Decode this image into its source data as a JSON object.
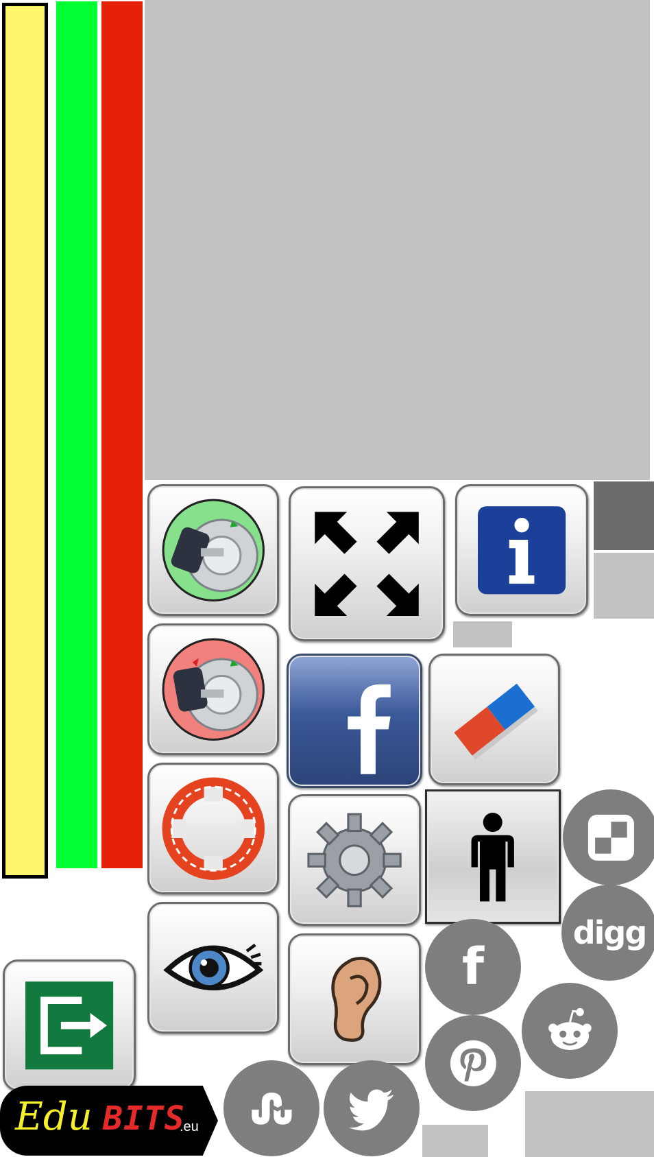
{
  "sprite": {
    "bars": [
      {
        "name": "yellow",
        "color": "#fff66e",
        "border": "#000000"
      },
      {
        "name": "green",
        "color": "#00ff33"
      },
      {
        "name": "red",
        "color": "#e42106"
      }
    ],
    "panel_color": "#c2c2c2",
    "circle_icon_color": "#7e7e7e",
    "info_blue": "#1c3f9a",
    "exit_green": "#127a3e",
    "facebook_blue": "#3b5998"
  },
  "icons": {
    "exit": "exit-icon",
    "key_on": "key-ignition-green-icon",
    "key_off": "key-ignition-red-icon",
    "lifebuoy": "lifebuoy-icon",
    "eye": "eye-icon",
    "fullscreen": "fullscreen-arrows-icon",
    "facebook": "facebook-icon",
    "gear": "gear-icon",
    "ear": "ear-icon",
    "info": "info-icon",
    "eraser": "eraser-icon",
    "person": "person-icon",
    "delicious": "delicious-icon",
    "digg": "digg-icon",
    "facebook_social": "facebook-social-icon",
    "reddit": "reddit-icon",
    "pinterest": "pinterest-icon",
    "stumbleupon": "stumbleupon-icon",
    "twitter": "twitter-icon"
  },
  "social": {
    "digg_label": "digg",
    "facebook_label": "f",
    "info_label": "i"
  },
  "logo": {
    "edu": "Edu",
    "bits": "BITS",
    "tld": ".eu"
  }
}
